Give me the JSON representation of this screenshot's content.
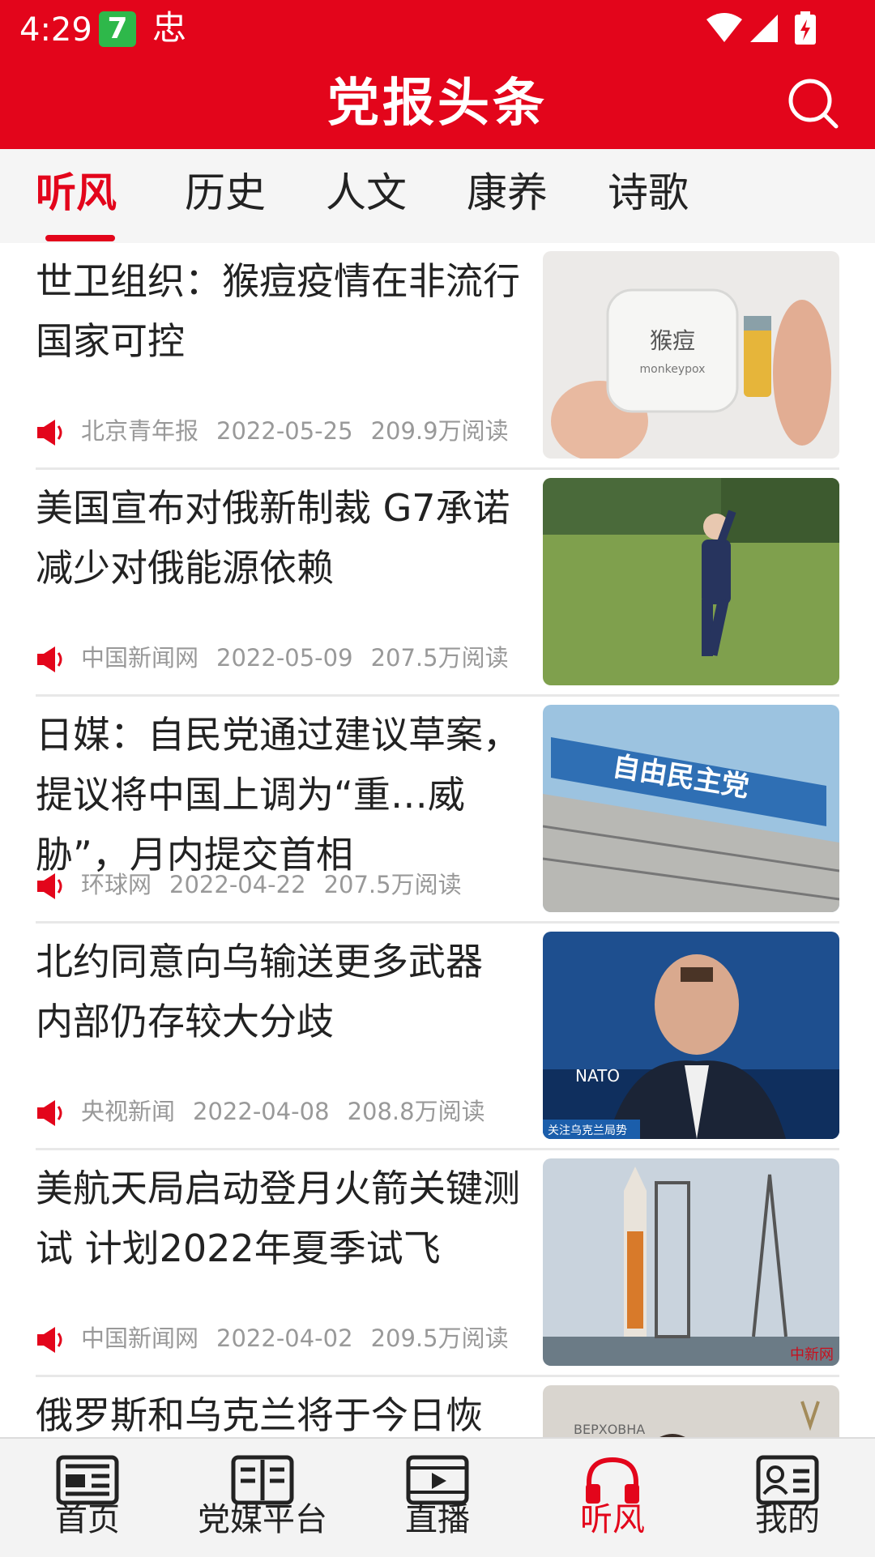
{
  "status_bar": {
    "time": "4:29",
    "badge": "7",
    "app_icon": "忠"
  },
  "header": {
    "title": "党报头条",
    "search_icon": "search-icon"
  },
  "tabs": [
    {
      "label": "听风",
      "active": true
    },
    {
      "label": "历史",
      "active": false
    },
    {
      "label": "人文",
      "active": false
    },
    {
      "label": "康养",
      "active": false
    },
    {
      "label": "诗歌",
      "active": false
    }
  ],
  "news": [
    {
      "title": "世卫组织：猴痘疫情在非流行国家可控",
      "source": "北京青年报",
      "date": "2022-05-25",
      "reads": "209.9万阅读",
      "thumb_text": "猴痘",
      "thumb_sub": "monkeypox"
    },
    {
      "title": "美国宣布对俄新制裁 G7承诺减少对俄能源依赖",
      "source": "中国新闻网",
      "date": "2022-05-09",
      "reads": "207.5万阅读"
    },
    {
      "title": "日媒：自民党通过建议草案，提议将中国上调为“重…威胁”，月内提交首相",
      "source": "环球网",
      "date": "2022-04-22",
      "reads": "207.5万阅读",
      "thumb_text": "自由民主党"
    },
    {
      "title": "北约同意向乌输送更多武器 内部仍存较大分歧",
      "source": "央视新闻",
      "date": "2022-04-08",
      "reads": "208.8万阅读",
      "thumb_text": "NATO",
      "thumb_sub": "关注乌克兰局势"
    },
    {
      "title": "美航天局启动登月火箭关键测试 计划2022年夏季试飞",
      "source": "中国新闻网",
      "date": "2022-04-02",
      "reads": "209.5万阅读",
      "thumb_text": "中新网"
    },
    {
      "title": "俄罗斯和乌克兰将于今日恢",
      "thumb_text": "ВЕРХОВНА"
    }
  ],
  "bottom_nav": [
    {
      "label": "首页",
      "icon": "news-icon",
      "active": false
    },
    {
      "label": "党媒平台",
      "icon": "book-icon",
      "active": false
    },
    {
      "label": "直播",
      "icon": "video-icon",
      "active": false
    },
    {
      "label": "听风",
      "icon": "headphones-icon",
      "active": true
    },
    {
      "label": "我的",
      "icon": "profile-card-icon",
      "active": false
    }
  ],
  "colors": {
    "brand_red": "#e3051b",
    "meta_gray": "#999999"
  }
}
